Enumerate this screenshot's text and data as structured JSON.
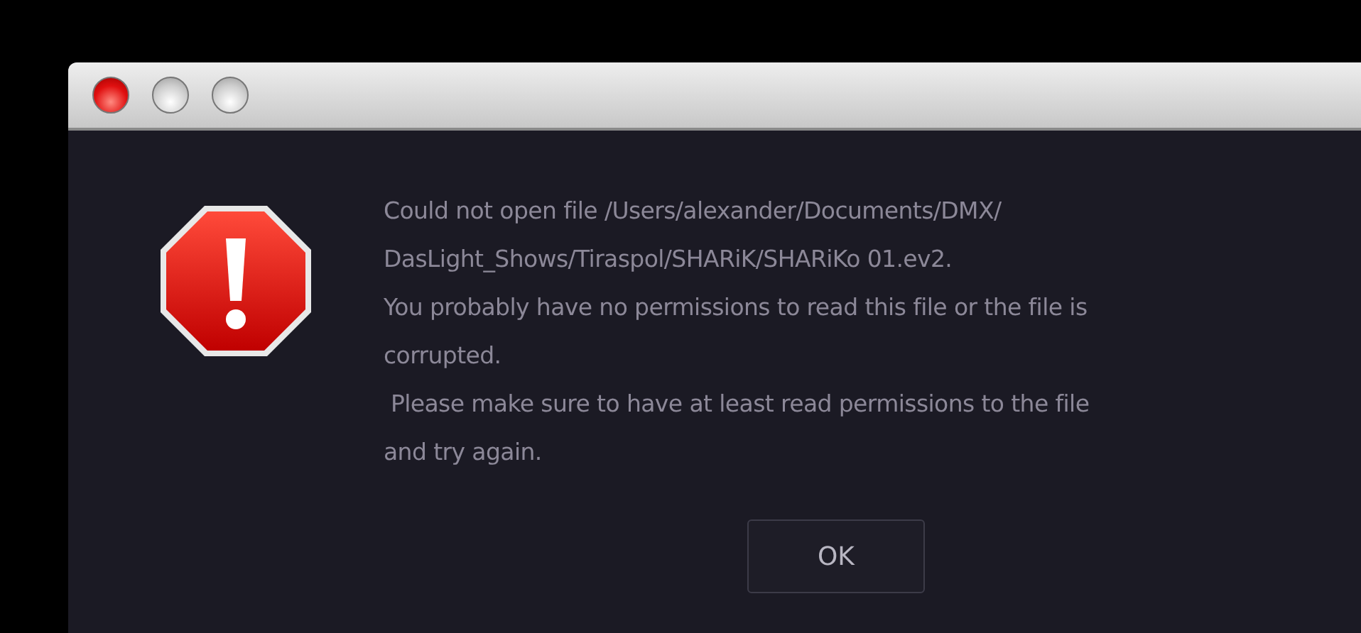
{
  "window": {
    "controls": [
      {
        "kind": "close"
      },
      {
        "kind": "minimize"
      },
      {
        "kind": "zoom"
      }
    ]
  },
  "alert": {
    "kind": "error",
    "message_lines": [
      "Could not open file /Users/alexander/Documents/DMX/",
      "DasLight_Shows/Tiraspol/SHARiK/SHARiKo 01.ev2.",
      "You probably have no permissions to read this file or the file is",
      "corrupted.",
      " Please make sure to have at least read permissions to the file",
      "and try again."
    ]
  },
  "buttons": [
    "OK"
  ]
}
